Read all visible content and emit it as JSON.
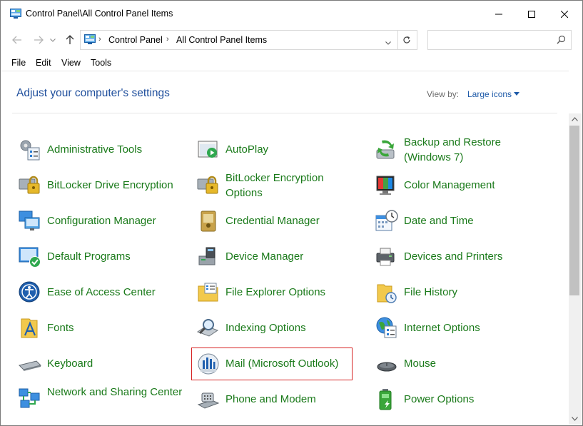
{
  "window": {
    "title": "Control Panel\\All Control Panel Items"
  },
  "address": {
    "crumbs": [
      "Control Panel",
      "All Control Panel Items"
    ],
    "search_placeholder": ""
  },
  "menu": [
    "File",
    "Edit",
    "View",
    "Tools"
  ],
  "header": {
    "heading": "Adjust your computer's settings",
    "view_by_label": "View by:",
    "view_by_value": "Large icons"
  },
  "items": [
    {
      "label": "Administrative Tools",
      "icon": "administrative-tools-icon"
    },
    {
      "label": "AutoPlay",
      "icon": "autoplay-icon"
    },
    {
      "label": "Backup and Restore (Windows 7)",
      "icon": "backup-restore-icon"
    },
    {
      "label": "BitLocker Drive Encryption",
      "icon": "bitlocker-icon"
    },
    {
      "label": "BitLocker Encryption Options",
      "icon": "bitlocker-options-icon"
    },
    {
      "label": "Color Management",
      "icon": "color-management-icon"
    },
    {
      "label": "Configuration Manager",
      "icon": "configuration-manager-icon"
    },
    {
      "label": "Credential Manager",
      "icon": "credential-manager-icon"
    },
    {
      "label": "Date and Time",
      "icon": "date-time-icon"
    },
    {
      "label": "Default Programs",
      "icon": "default-programs-icon"
    },
    {
      "label": "Device Manager",
      "icon": "device-manager-icon"
    },
    {
      "label": "Devices and Printers",
      "icon": "devices-printers-icon"
    },
    {
      "label": "Ease of Access Center",
      "icon": "ease-of-access-icon"
    },
    {
      "label": "File Explorer Options",
      "icon": "file-explorer-options-icon"
    },
    {
      "label": "File History",
      "icon": "file-history-icon"
    },
    {
      "label": "Fonts",
      "icon": "fonts-icon"
    },
    {
      "label": "Indexing Options",
      "icon": "indexing-options-icon"
    },
    {
      "label": "Internet Options",
      "icon": "internet-options-icon"
    },
    {
      "label": "Keyboard",
      "icon": "keyboard-icon"
    },
    {
      "label": "Mail (Microsoft Outlook)",
      "icon": "mail-outlook-icon"
    },
    {
      "label": "Mouse",
      "icon": "mouse-icon"
    },
    {
      "label": "Network and Sharing Center",
      "icon": "network-sharing-icon"
    },
    {
      "label": "Phone and Modem",
      "icon": "phone-modem-icon"
    },
    {
      "label": "Power Options",
      "icon": "power-options-icon"
    }
  ],
  "colors": {
    "link_green": "#1a7a1a",
    "heading_blue": "#1e4e9c",
    "highlight_red": "#d62424"
  }
}
